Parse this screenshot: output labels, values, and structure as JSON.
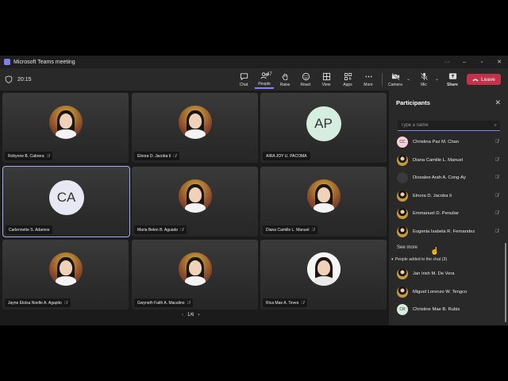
{
  "window": {
    "title": "Microsoft Teams meeting"
  },
  "toolbar": {
    "timer": "20:15",
    "buttons": [
      {
        "label": "Chat",
        "icon": "chat-icon"
      },
      {
        "label": "People",
        "icon": "people-icon",
        "count": "47"
      },
      {
        "label": "Raise",
        "icon": "hand-icon"
      },
      {
        "label": "React",
        "icon": "smile-icon"
      },
      {
        "label": "View",
        "icon": "grid-icon"
      },
      {
        "label": "Apps",
        "icon": "apps-icon"
      },
      {
        "label": "More",
        "icon": "more-icon"
      },
      {
        "label": "Camera",
        "icon": "camera-off-icon"
      },
      {
        "label": "Mic",
        "icon": "mic-off-icon"
      },
      {
        "label": "Share",
        "icon": "share-icon"
      }
    ],
    "leave_label": "Leave"
  },
  "grid": {
    "tiles": [
      {
        "name": "Robynne B. Cabrera",
        "type": "photo"
      },
      {
        "name": "Elnora D. Jacoba Ii",
        "type": "photo"
      },
      {
        "name": "AIRA JOY U. PACOMA",
        "type": "initials",
        "initials": "AP",
        "bg": "#d6eee0",
        "fg": "#333333"
      },
      {
        "name": "Carlennette S. Adamos",
        "type": "initials",
        "initials": "CA",
        "bg": "#e8e8f4",
        "fg": "#333333"
      },
      {
        "name": "Maria Belen B. Aguado",
        "type": "photo"
      },
      {
        "name": "Diana Camille L. Manuel",
        "type": "photo"
      },
      {
        "name": "Jayne Eloisa Noelle A. Agapito",
        "type": "photo"
      },
      {
        "name": "Gwyneth Faith A. Macalino",
        "type": "photo"
      },
      {
        "name": "Rica Mae A. Teves",
        "type": "plain-photo"
      }
    ],
    "page": "1/6"
  },
  "panel": {
    "title": "Participants",
    "search_placeholder": "Type a name",
    "participants": [
      {
        "name": "Christina Paz M. Chan",
        "avatar": "initials",
        "initials": "CC",
        "bg": "#f7d3d9"
      },
      {
        "name": "Diana Camille L. Manuel",
        "avatar": "photo"
      },
      {
        "name": "Diosalee Arah A. Cong-Ay",
        "avatar": "dark"
      },
      {
        "name": "Elnora D. Jacoba Ii",
        "avatar": "photo"
      },
      {
        "name": "Emmanuel D. Penuliar",
        "avatar": "photo"
      },
      {
        "name": "Eugenia Isabela R. Fernandez",
        "avatar": "photo"
      }
    ],
    "see_more": "See more",
    "chat_section": "People added to the chat (3)",
    "chat_people": [
      {
        "name": "Jan Irish M. De Vera",
        "avatar": "photo"
      },
      {
        "name": "Miguel Lorenzo W. Tengco",
        "avatar": "photo"
      },
      {
        "name": "Christine Mae B. Rubis",
        "avatar": "initials",
        "initials": "CR",
        "bg": "#d6eee0"
      }
    ]
  },
  "colors": {
    "accent": "#7f85f5",
    "leave": "#c4314b",
    "panel": "#292929",
    "grid": "#1b1b1b"
  }
}
